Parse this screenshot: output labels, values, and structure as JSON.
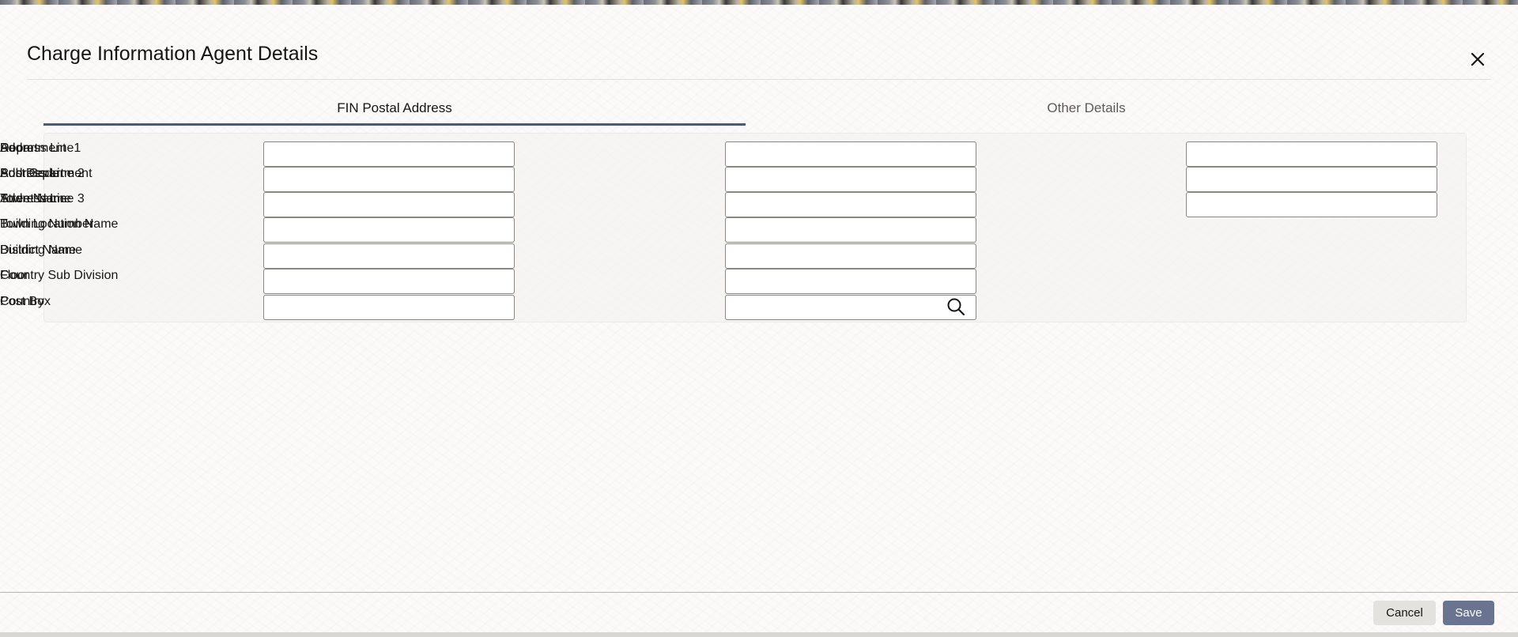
{
  "dialog": {
    "title": "Charge Information Agent Details",
    "close_icon": "close-icon"
  },
  "tabs": [
    {
      "label": "FIN Postal Address",
      "active": true
    },
    {
      "label": "Other Details",
      "active": false
    }
  ],
  "form": {
    "col1": [
      {
        "label": "Department",
        "value": ""
      },
      {
        "label": "Sub Department",
        "value": ""
      },
      {
        "label": "Street Name",
        "value": ""
      },
      {
        "label": "Building Number",
        "value": ""
      },
      {
        "label": "Building Name",
        "value": ""
      },
      {
        "label": "Floor",
        "value": ""
      },
      {
        "label": "Post Box",
        "value": ""
      }
    ],
    "col2": [
      {
        "label": "Room",
        "value": ""
      },
      {
        "label": "Post Code",
        "value": ""
      },
      {
        "label": "Town Name",
        "value": ""
      },
      {
        "label": "Town Location Name",
        "value": ""
      },
      {
        "label": "District Name",
        "value": ""
      },
      {
        "label": "Country Sub Division",
        "value": ""
      },
      {
        "label": "Country",
        "value": "",
        "lookup_icon": "search-icon"
      }
    ],
    "col3": [
      {
        "label": "Address Line1",
        "value": ""
      },
      {
        "label": "Address Line 2",
        "value": ""
      },
      {
        "label": "Address Line 3",
        "value": ""
      }
    ]
  },
  "footer": {
    "cancel_label": "Cancel",
    "save_label": "Save"
  },
  "colors": {
    "active_tab_underline": "#4e5a72",
    "save_button": "#6a7390",
    "cancel_button": "#e4e2de"
  }
}
